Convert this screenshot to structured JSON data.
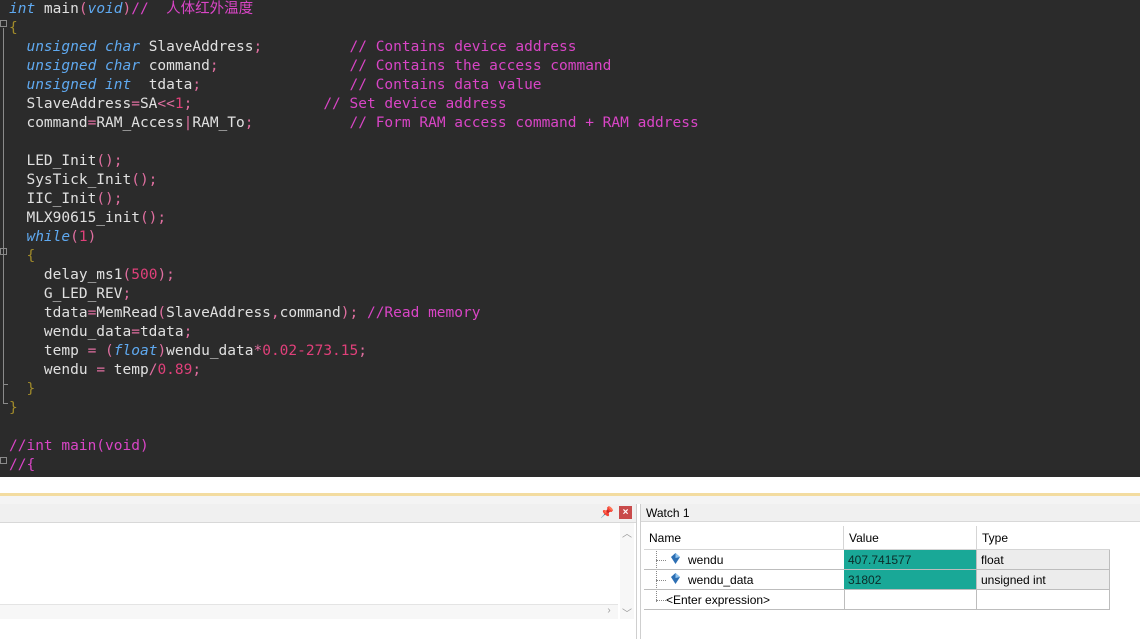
{
  "editor": {
    "lines": [
      [
        [
          "kw",
          "int"
        ],
        [
          "id",
          " main"
        ],
        [
          "op",
          "("
        ],
        [
          "kw",
          "void"
        ],
        [
          "op",
          ")"
        ],
        [
          "cm",
          "//  人体红外温度"
        ]
      ],
      [
        [
          "pu",
          "{"
        ]
      ],
      [
        [
          "id",
          "  "
        ],
        [
          "kw",
          "unsigned char"
        ],
        [
          "id",
          " SlaveAddress"
        ],
        [
          "op",
          ";"
        ],
        [
          "id",
          "          "
        ],
        [
          "cm",
          "// Contains device address"
        ]
      ],
      [
        [
          "id",
          "  "
        ],
        [
          "kw",
          "unsigned char"
        ],
        [
          "id",
          " command"
        ],
        [
          "op",
          ";"
        ],
        [
          "id",
          "               "
        ],
        [
          "cm",
          "// Contains the access command"
        ]
      ],
      [
        [
          "id",
          "  "
        ],
        [
          "kw",
          "unsigned int"
        ],
        [
          "id",
          "  tdata"
        ],
        [
          "op",
          ";"
        ],
        [
          "id",
          "                 "
        ],
        [
          "cm",
          "// Contains data value"
        ]
      ],
      [
        [
          "id",
          "  SlaveAddress"
        ],
        [
          "op",
          "="
        ],
        [
          "id",
          "SA"
        ],
        [
          "op",
          "<<"
        ],
        [
          "num",
          "1"
        ],
        [
          "op",
          ";"
        ],
        [
          "id",
          "               "
        ],
        [
          "cm",
          "// Set device address"
        ]
      ],
      [
        [
          "id",
          "  command"
        ],
        [
          "op",
          "="
        ],
        [
          "id",
          "RAM_Access"
        ],
        [
          "op",
          "|"
        ],
        [
          "id",
          "RAM_To"
        ],
        [
          "op",
          ";"
        ],
        [
          "id",
          "           "
        ],
        [
          "cm",
          "// Form RAM access command + RAM address"
        ]
      ],
      [],
      [
        [
          "id",
          "  LED_Init"
        ],
        [
          "op",
          "();"
        ]
      ],
      [
        [
          "id",
          "  SysTick_Init"
        ],
        [
          "op",
          "();"
        ]
      ],
      [
        [
          "id",
          "  IIC_Init"
        ],
        [
          "op",
          "();"
        ]
      ],
      [
        [
          "id",
          "  MLX90615_init"
        ],
        [
          "op",
          "();"
        ]
      ],
      [
        [
          "id",
          "  "
        ],
        [
          "kw",
          "while"
        ],
        [
          "op",
          "("
        ],
        [
          "num",
          "1"
        ],
        [
          "op",
          ")"
        ]
      ],
      [
        [
          "id",
          "  "
        ],
        [
          "pu",
          "{"
        ]
      ],
      [
        [
          "id",
          "    delay_ms1"
        ],
        [
          "op",
          "("
        ],
        [
          "num",
          "500"
        ],
        [
          "op",
          ");"
        ]
      ],
      [
        [
          "id",
          "    G_LED_REV"
        ],
        [
          "op",
          ";"
        ]
      ],
      [
        [
          "id",
          "    tdata"
        ],
        [
          "op",
          "="
        ],
        [
          "id",
          "MemRead"
        ],
        [
          "op",
          "("
        ],
        [
          "id",
          "SlaveAddress"
        ],
        [
          "op",
          ","
        ],
        [
          "id",
          "command"
        ],
        [
          "op",
          ");"
        ],
        [
          "id",
          " "
        ],
        [
          "cm",
          "//Read memory"
        ]
      ],
      [
        [
          "id",
          "    wendu_data"
        ],
        [
          "op",
          "="
        ],
        [
          "id",
          "tdata"
        ],
        [
          "op",
          ";"
        ]
      ],
      [
        [
          "id",
          "    temp "
        ],
        [
          "op",
          "="
        ],
        [
          "id",
          " "
        ],
        [
          "op",
          "("
        ],
        [
          "kw",
          "float"
        ],
        [
          "op",
          ")"
        ],
        [
          "id",
          "wendu_data"
        ],
        [
          "op",
          "*"
        ],
        [
          "num",
          "0.02-273.15"
        ],
        [
          "op",
          ";"
        ]
      ],
      [
        [
          "id",
          "    wendu "
        ],
        [
          "op",
          "="
        ],
        [
          "id",
          " temp"
        ],
        [
          "op",
          "/"
        ],
        [
          "num",
          "0.89"
        ],
        [
          "op",
          ";"
        ]
      ],
      [
        [
          "id",
          "  "
        ],
        [
          "pu",
          "}"
        ]
      ],
      [
        [
          "pu",
          "}"
        ]
      ],
      [],
      [
        [
          "cm",
          "//int main(void)"
        ]
      ],
      [
        [
          "cm",
          "//{"
        ]
      ]
    ]
  },
  "left_panel": {
    "pin_glyph": "📌",
    "close_glyph": "×"
  },
  "watch": {
    "title": "Watch 1",
    "columns": {
      "name": "Name",
      "value": "Value",
      "type": "Type"
    },
    "rows": [
      {
        "name": "wendu",
        "value": "407.741577",
        "type": "float"
      },
      {
        "name": "wendu_data",
        "value": "31802",
        "type": "unsigned int"
      }
    ],
    "placeholder": "<Enter expression>",
    "highlight_color": "#19a897"
  },
  "colors": {
    "editor_bg": "#2b2b2b",
    "keyword": "#5fa9f0",
    "comment": "#d945c6",
    "number": "#e0407a",
    "operator": "#e06fa0"
  }
}
